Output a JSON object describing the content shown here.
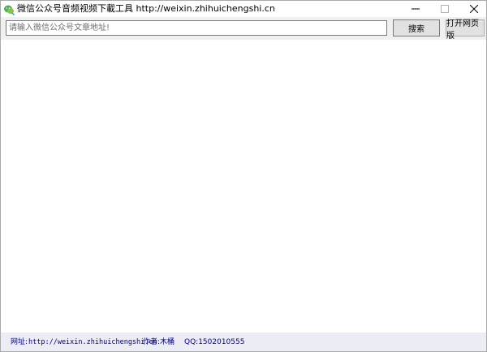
{
  "window": {
    "title": "微信公众号音频视频下載工具 http://weixin.zhihuichengshi.cn"
  },
  "toolbar": {
    "url_placeholder": "请输入微信公众号文章地址!",
    "url_value": "",
    "search_label": "搜索",
    "open_label": "打开网页版"
  },
  "status": {
    "site_label": "网址:",
    "site_url": "http://weixin.zhihuichengshi.cn",
    "author": "作者:木桶",
    "qq": "QQ:1502010555"
  },
  "colors": {
    "status_bg": "#ececf4",
    "status_text": "#00008b",
    "toolbar_bg": "#f0f0f0"
  }
}
